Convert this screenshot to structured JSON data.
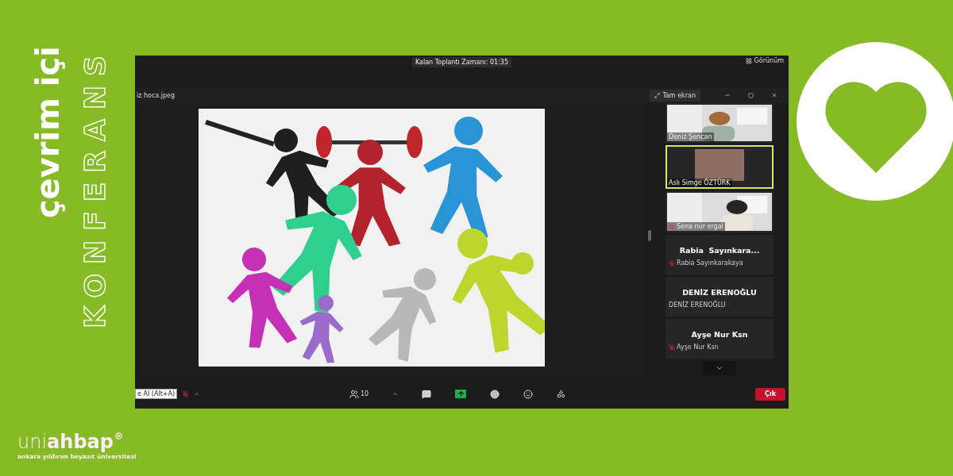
{
  "sidebar_text": {
    "headline": "çevrim içi",
    "subheadline": "KONFERANS"
  },
  "logo": {
    "wordmark": "uni**ahbap**",
    "tagline": "ankara yıldırım beyazıt üniversitesi"
  },
  "meeting": {
    "timer": "Kalan Toplantı Zamanı: 01:35",
    "view_button": "Görünüm",
    "shared_window": {
      "title": "iz hoca.jpeg",
      "fullscreen_button": "Tam ekran"
    },
    "participants": [
      {
        "name": "Deniz Şencan",
        "kind": "video",
        "muted": false,
        "speaking": false
      },
      {
        "name": "Aslı Simge ÖZTÜRK",
        "kind": "avatar",
        "muted": false,
        "speaking": true
      },
      {
        "name": "Sena nur ergal",
        "kind": "video",
        "muted": true,
        "speaking": false
      },
      {
        "display_name": "Rabia  Sayınkara...",
        "name": "Rabia Sayınkarakaya",
        "kind": "name",
        "muted": true,
        "speaking": false
      },
      {
        "display_name": "DENİZ ERENOĞLU",
        "name": "DENİZ ERENOĞLU",
        "kind": "name",
        "muted": false,
        "speaking": false
      },
      {
        "display_name": "Ayşe Nur Ksn",
        "name": "Ayşe Nur Ksn",
        "kind": "name",
        "muted": true,
        "speaking": false
      }
    ],
    "toolbar": {
      "tooltip": "e AI (Alt+A)",
      "items": [
        {
          "kind": "participants",
          "count": "10"
        },
        {
          "kind": "chat"
        },
        {
          "kind": "share"
        },
        {
          "kind": "record"
        },
        {
          "kind": "reactions"
        },
        {
          "kind": "apps"
        }
      ]
    },
    "leave_button": "Çık"
  }
}
